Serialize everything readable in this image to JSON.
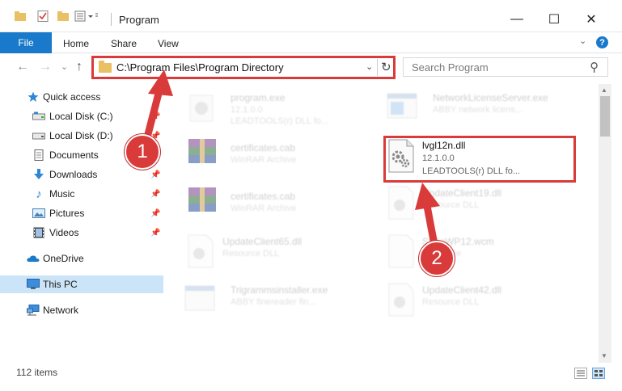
{
  "window": {
    "title": "Program",
    "minimize": "—",
    "maximize": "☐",
    "close": "✕"
  },
  "ribbon": {
    "file": "File",
    "tabs": [
      "Home",
      "Share",
      "View"
    ],
    "collapse": "⌄",
    "help": "?"
  },
  "nav": {
    "back": "←",
    "forward": "→",
    "recent": "⌄",
    "up": "↑"
  },
  "address": {
    "path": "C:\\Program Files\\Program Directory",
    "dropdown": "⌄",
    "refresh": "↻"
  },
  "search": {
    "placeholder": "Search Program"
  },
  "sidebar": {
    "items": [
      {
        "label": "Quick access",
        "icon": "star-icon"
      },
      {
        "label": "Local Disk (C:)",
        "icon": "drive-icon",
        "pinned": true
      },
      {
        "label": "Local Disk (D:)",
        "icon": "drive-icon",
        "pinned": true
      },
      {
        "label": "Documents",
        "icon": "documents-icon",
        "pinned": true
      },
      {
        "label": "Downloads",
        "icon": "downloads-icon",
        "pinned": true
      },
      {
        "label": "Music",
        "icon": "music-icon",
        "pinned": true
      },
      {
        "label": "Pictures",
        "icon": "pictures-icon",
        "pinned": true
      },
      {
        "label": "Videos",
        "icon": "videos-icon",
        "pinned": true
      },
      {
        "label": "OneDrive",
        "icon": "cloud-icon"
      },
      {
        "label": "This PC",
        "icon": "computer-icon",
        "selected": true
      },
      {
        "label": "Network",
        "icon": "network-icon"
      }
    ]
  },
  "files": [
    {
      "name": "program.exe",
      "line2": "12.1.0.0",
      "line3": "LEADTOOLS(r) DLL fo...",
      "icon": "app-icon"
    },
    {
      "name": "NetworkLicenseServer.exe",
      "line2": "ABBY network licens...",
      "line3": "",
      "icon": "app-window-icon"
    },
    {
      "name": "certificates.cab",
      "line2": "WinRAR Archive",
      "line3": "",
      "icon": "archive-icon"
    },
    {
      "name": "lvgl12n.dll",
      "line2": "12.1.0.0",
      "line3": "LEADTOOLS(r) DLL fo...",
      "icon": "dll-gear-icon"
    },
    {
      "name": "certificates.cab",
      "line2": "WinRAR Archive",
      "line3": "",
      "icon": "archive-icon"
    },
    {
      "name": "UpdateClient19.dll",
      "line2": "Resource DLL",
      "line3": "",
      "icon": "dll-gear-icon"
    },
    {
      "name": "UpdateClient65.dll",
      "line2": "Resource DLL",
      "line3": "",
      "icon": "dll-gear-icon"
    },
    {
      "name": "StdIoWP12.wcm",
      "line2": "WCM File",
      "line3": "",
      "icon": "blank-file-icon"
    },
    {
      "name": "Trigrammsinstaller.exe",
      "line2": "ABBY finereader fin...",
      "line3": "",
      "icon": "app-window-icon"
    },
    {
      "name": "UpdateClient42.dll",
      "line2": "Resource DLL",
      "line3": "",
      "icon": "dll-gear-icon"
    }
  ],
  "status": {
    "count": "112 items"
  },
  "callouts": {
    "one": "1",
    "two": "2"
  },
  "colors": {
    "accent": "#1979ca",
    "callout": "#d93a3a",
    "selected_bg": "#cce4f7"
  }
}
